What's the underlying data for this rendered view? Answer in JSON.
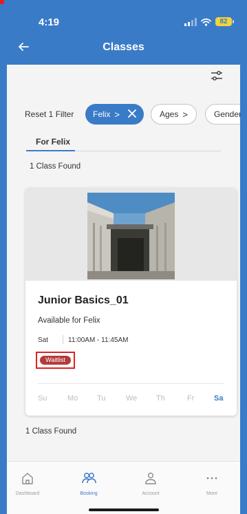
{
  "status_bar": {
    "time": "4:19",
    "battery": "82"
  },
  "header": {
    "title": "Classes"
  },
  "filters": {
    "reset_label": "Reset 1 Filter",
    "active_chip": "Felix",
    "chips": [
      "Ages",
      "Genders"
    ]
  },
  "tab": {
    "label": "For Felix"
  },
  "results": {
    "count_top": "1 Class Found",
    "count_bottom": "1 Class Found"
  },
  "class_card": {
    "name": "Junior Basics_01",
    "availability": "Available for Felix",
    "day": "Sat",
    "time": "11:00AM - 11:45AM",
    "status_badge": "Waitlist",
    "weekdays": [
      "Su",
      "Mo",
      "Tu",
      "We",
      "Th",
      "Fr",
      "Sa"
    ],
    "active_weekday": "Sa"
  },
  "bottom_nav": [
    {
      "label": "Dashboard",
      "icon": "home-icon",
      "active": false
    },
    {
      "label": "Booking",
      "icon": "people-icon",
      "active": true
    },
    {
      "label": "Account",
      "icon": "person-icon",
      "active": false
    },
    {
      "label": "More",
      "icon": "more-icon",
      "active": false
    }
  ],
  "colors": {
    "brand": "#3a7bc8",
    "waitlist": "#b33a3a",
    "highlight": "#e02020"
  }
}
